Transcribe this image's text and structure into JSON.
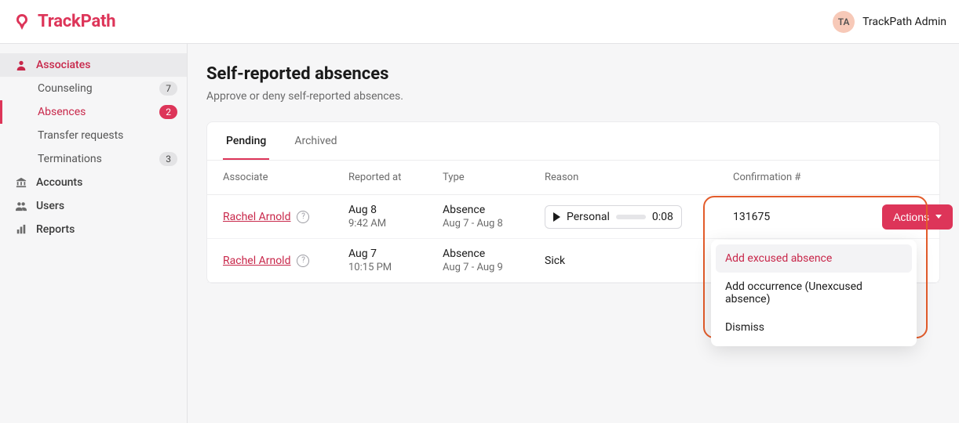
{
  "brand": {
    "name": "TrackPath"
  },
  "user": {
    "initials": "TA",
    "name": "TrackPath Admin"
  },
  "sidebar": {
    "items": [
      {
        "label": "Associates"
      },
      {
        "label": "Accounts"
      },
      {
        "label": "Users"
      },
      {
        "label": "Reports"
      }
    ],
    "subitems": [
      {
        "label": "Counseling",
        "badge": "7"
      },
      {
        "label": "Absences",
        "badge": "2"
      },
      {
        "label": "Transfer requests",
        "badge": ""
      },
      {
        "label": "Terminations",
        "badge": "3"
      }
    ]
  },
  "page": {
    "title": "Self-reported absences",
    "subtitle": "Approve or deny self-reported absences."
  },
  "tabs": [
    {
      "label": "Pending"
    },
    {
      "label": "Archived"
    }
  ],
  "columns": {
    "associate": "Associate",
    "reported_at": "Reported at",
    "type": "Type",
    "reason": "Reason",
    "confirmation": "Confirmation #"
  },
  "rows": [
    {
      "associate": "Rachel Arnold",
      "reported_date": "Aug 8",
      "reported_time": "9:42 AM",
      "type_label": "Absence",
      "type_range": "Aug 7 - Aug 8",
      "reason_kind": "audio",
      "reason_label": "Personal",
      "duration": "0:08",
      "confirmation": "131675"
    },
    {
      "associate": "Rachel Arnold",
      "reported_date": "Aug 7",
      "reported_time": "10:15 PM",
      "type_label": "Absence",
      "type_range": "Aug 7 - Aug 9",
      "reason_kind": "text",
      "reason_label": "Sick",
      "duration": "",
      "confirmation": ""
    }
  ],
  "actions_button": "Actions",
  "dropdown": [
    "Add excused absence",
    "Add occurrence (Unexcused absence)",
    "Dismiss"
  ]
}
